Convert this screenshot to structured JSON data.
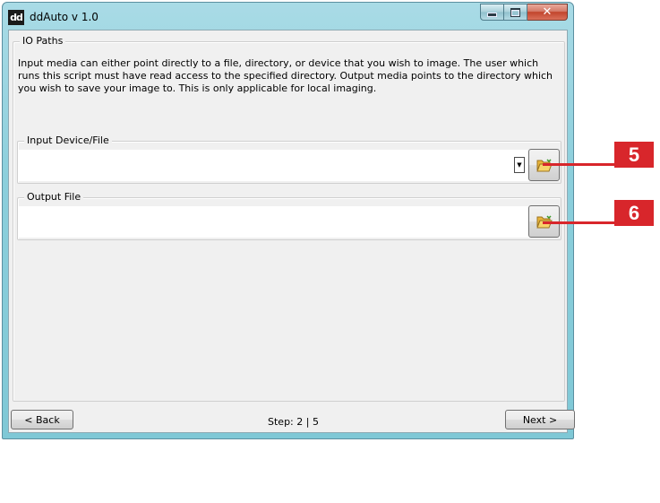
{
  "window": {
    "title": "ddAuto v 1.0",
    "app_icon_text": "dd",
    "close_glyph": "✕"
  },
  "io_paths": {
    "legend": "IO Paths",
    "description": "Input media can either point directly to a file, directory, or device that you wish to image. The user which runs this script must have read access to the specified directory. Output media points to the directory which you wish to save your image to. This is only applicable for local imaging."
  },
  "input_device": {
    "legend": "Input Device/File",
    "value": "",
    "dropdown_arrow": "▼",
    "browse_icon": "folder-open-icon"
  },
  "output_file": {
    "legend": "Output File",
    "value": "",
    "browse_icon": "folder-open-icon"
  },
  "footer": {
    "back_label": "< Back",
    "next_label": "Next >",
    "step_text": "Step: 2 | 5"
  },
  "callouts": [
    "5",
    "6"
  ],
  "colors": {
    "callout": "#d8262b",
    "window_frame": "#8ccfdc",
    "client_bg": "#f0f0f0"
  }
}
